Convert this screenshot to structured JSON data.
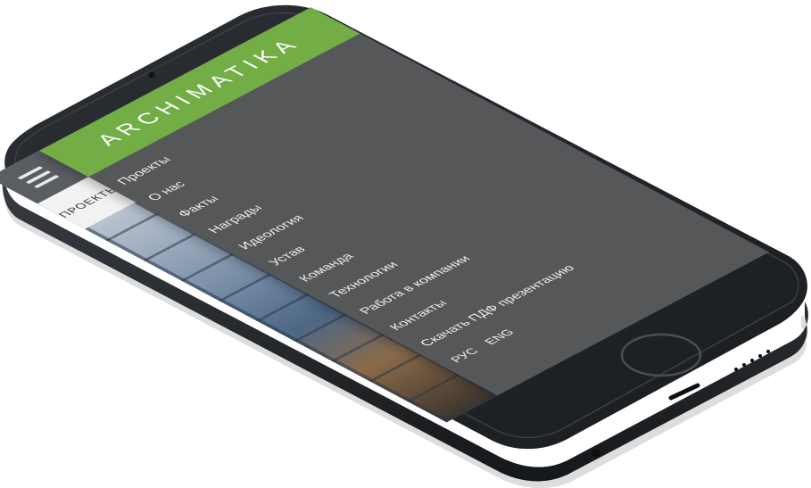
{
  "menu": {
    "logo": "ARCHIMATIKA",
    "items": [
      {
        "label": "Проекты"
      },
      {
        "label": "О нас"
      },
      {
        "label": "Факты"
      },
      {
        "label": "Награды"
      },
      {
        "label": "Идеология"
      },
      {
        "label": "Устав"
      },
      {
        "label": "Команда"
      },
      {
        "label": "Технологии"
      },
      {
        "label": "Работа в компании"
      },
      {
        "label": "Контакты"
      },
      {
        "label": "Скачать ПДФ презентацию"
      }
    ],
    "languages": {
      "ru": "РУС",
      "en": "ENG"
    }
  },
  "page": {
    "tab_label": "ПРОЕКТЫ"
  },
  "colors": {
    "accent_green": "#72ad46",
    "menu_bg": "#555759",
    "phone_body": "#23272b"
  },
  "icons": {
    "menu": "hamburger-menu-icon",
    "home_button": "home-button"
  }
}
